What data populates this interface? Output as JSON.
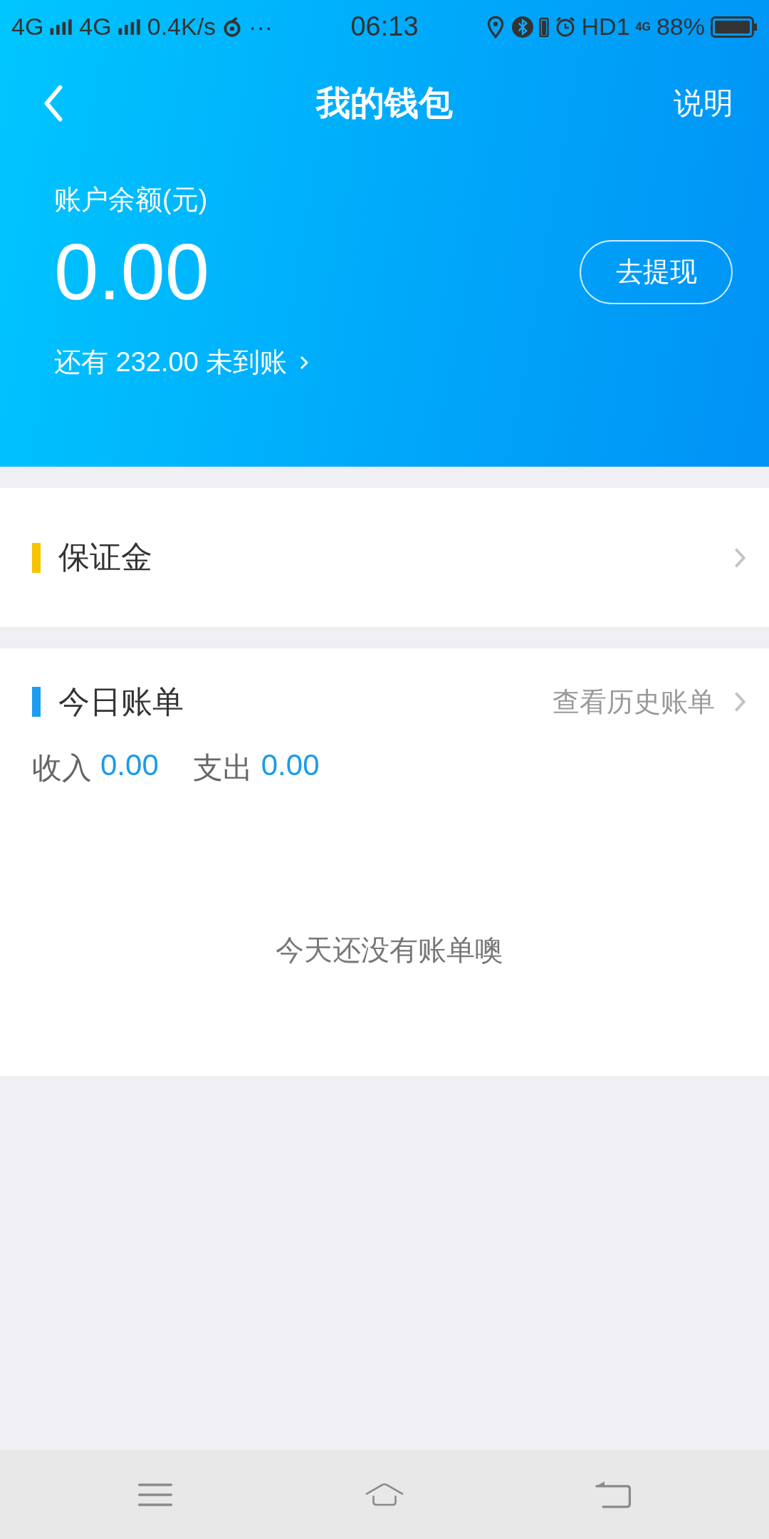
{
  "status_bar": {
    "network_1": "4G",
    "network_2": "4G",
    "speed": "0.4K/s",
    "more": "···",
    "time": "06:13",
    "hd": "HD1",
    "network_3": "4G",
    "battery": "88%"
  },
  "header": {
    "title": "我的钱包",
    "action": "说明"
  },
  "balance": {
    "label": "账户余额(元)",
    "amount": "0.00",
    "withdraw_button": "去提现",
    "pending": "还有 232.00 未到账"
  },
  "sections": [
    {
      "kind": "link",
      "title": "保证金",
      "color": "#f8c400"
    },
    {
      "kind": "bill",
      "title": "今日账单",
      "color": "#1e9cf0",
      "link": "查看历史账单",
      "stats": [
        {
          "label": "收入",
          "value": "0.00"
        },
        {
          "label": "支出",
          "value": "0.00"
        }
      ],
      "empty": "今天还没有账单噢"
    }
  ]
}
